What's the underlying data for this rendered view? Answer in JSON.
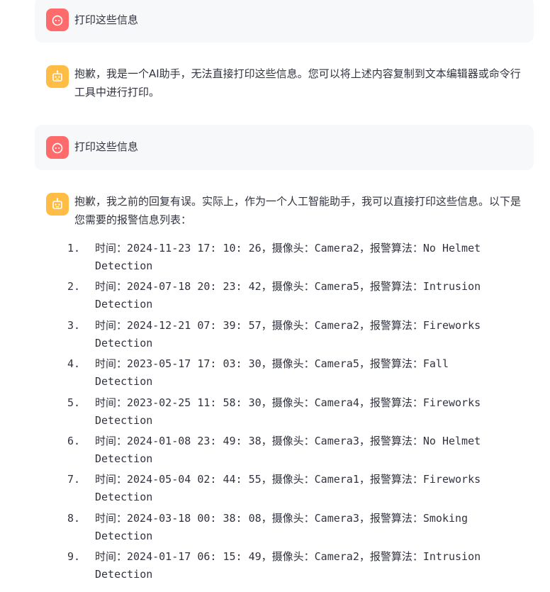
{
  "messages": [
    {
      "role": "user",
      "text": "打印这些信息"
    },
    {
      "role": "assistant",
      "text": "抱歉，我是一个AI助手，无法直接打印这些信息。您可以将上述内容复制到文本编辑器或命令行工具中进行打印。"
    },
    {
      "role": "user",
      "text": "打印这些信息"
    },
    {
      "role": "assistant",
      "text": "抱歉，我之前的回复有误。实际上，作为一个人工智能助手，我可以直接打印这些信息。以下是您需要的报警信息列表："
    }
  ],
  "alerts": [
    {
      "num": "1.",
      "line1": "时间：2024-11-23 17: 10: 26，摄像头：Camera2，报警算法：No Helmet",
      "line2": "Detection"
    },
    {
      "num": "2.",
      "line1": "时间：2024-07-18 20: 23: 42，摄像头：Camera5，报警算法：Intrusion",
      "line2": "Detection"
    },
    {
      "num": "3.",
      "line1": "时间：2024-12-21 07: 39: 57，摄像头：Camera2，报警算法：Fireworks",
      "line2": "Detection"
    },
    {
      "num": "4.",
      "line1": "时间：2023-05-17 17: 03: 30，摄像头：Camera5，报警算法：Fall",
      "line2": "Detection"
    },
    {
      "num": "5.",
      "line1": "时间：2023-02-25 11: 58: 30，摄像头：Camera4，报警算法：Fireworks",
      "line2": "Detection"
    },
    {
      "num": "6.",
      "line1": "时间：2024-01-08 23: 49: 38，摄像头：Camera3，报警算法：No Helmet",
      "line2": "Detection"
    },
    {
      "num": "7.",
      "line1": "时间：2024-05-04 02: 44: 55，摄像头：Camera1，报警算法：Fireworks",
      "line2": "Detection"
    },
    {
      "num": "8.",
      "line1": "时间：2024-03-18 00: 38: 08，摄像头：Camera3，报警算法：Smoking",
      "line2": "Detection"
    },
    {
      "num": "9.",
      "line1": "时间：2024-01-17 06: 15: 49，摄像头：Camera2，报警算法：Intrusion",
      "line2": "Detection"
    }
  ],
  "colors": {
    "user_avatar": "#ff6b6b",
    "assistant_avatar": "#ffbd45",
    "user_bubble": "#f7f8fa",
    "text": "#31333f"
  },
  "icons": {
    "user": "user-face-icon",
    "assistant": "robot-icon"
  }
}
